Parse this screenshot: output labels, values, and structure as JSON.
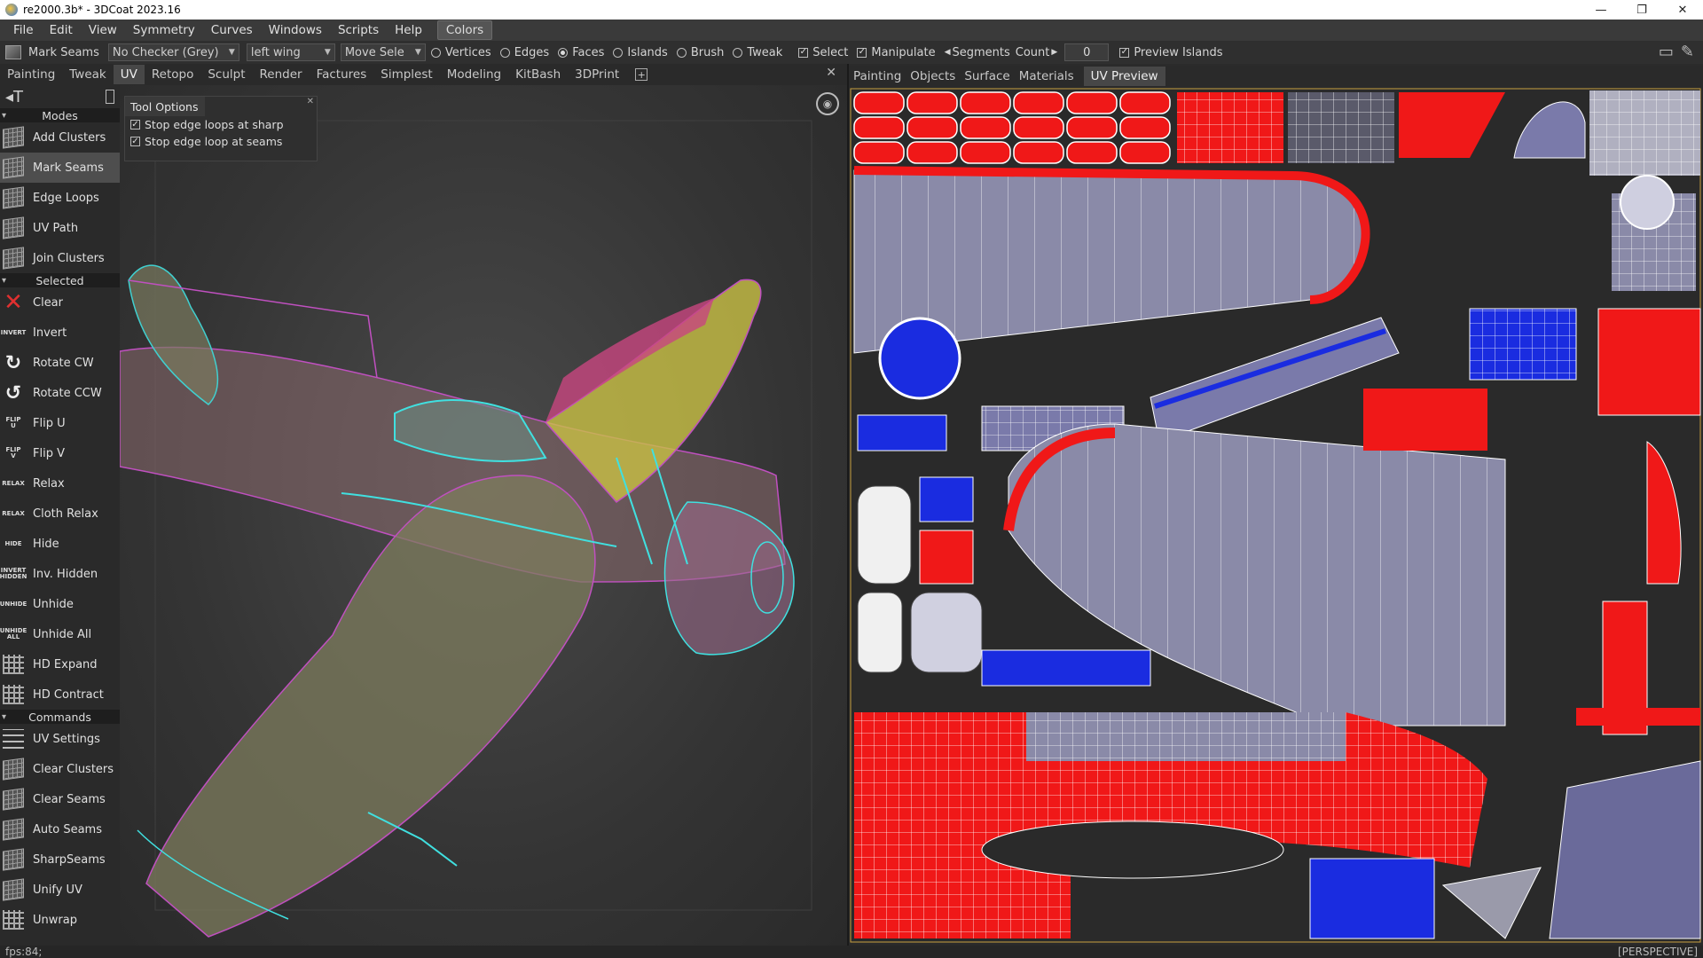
{
  "window": {
    "title": "re2000.3b* - 3DCoat 2023.16",
    "controls": [
      "—",
      "❐",
      "✕"
    ]
  },
  "menu": [
    "File",
    "Edit",
    "View",
    "Symmetry",
    "Curves",
    "Windows",
    "Scripts",
    "Help",
    "Colors"
  ],
  "toolbar": {
    "tool_label": "Mark Seams",
    "checker": "No Checker (Grey)",
    "object": "left wing",
    "move_sel": "Move Sele",
    "modes": [
      {
        "label": "Vertices",
        "on": false
      },
      {
        "label": "Edges",
        "on": false
      },
      {
        "label": "Faces",
        "on": true
      },
      {
        "label": "Islands",
        "on": false
      },
      {
        "label": "Brush",
        "on": false
      },
      {
        "label": "Tweak",
        "on": false
      }
    ],
    "select": "Select",
    "manipulate": "Manipulate",
    "segments_label": "Segments",
    "count_label": "Count",
    "count_value": "0",
    "preview_islands": "Preview Islands"
  },
  "tabs_left": [
    "Painting",
    "Tweak",
    "UV",
    "Retopo",
    "Sculpt",
    "Render",
    "Factures",
    "Simplest",
    "Modeling",
    "KitBash",
    "3DPrint"
  ],
  "tabs_left_active": "UV",
  "tabs_right": [
    "Painting",
    "Objects",
    "Surface",
    "Materials",
    "UV Preview"
  ],
  "tabs_right_active": "UV Preview",
  "panel": {
    "sections": {
      "modes": "Modes",
      "selected": "Selected",
      "commands": "Commands"
    },
    "modes": [
      {
        "label": "Add Clusters",
        "icon": "mesh-icon"
      },
      {
        "label": "Mark Seams",
        "icon": "mesh-icon",
        "active": true
      },
      {
        "label": "Edge Loops",
        "icon": "mesh-icon"
      },
      {
        "label": "UV Path",
        "icon": "mesh-icon"
      },
      {
        "label": "Join Clusters",
        "icon": "mesh-icon"
      }
    ],
    "selected": [
      {
        "label": "Clear",
        "icon_text": "✕"
      },
      {
        "label": "Invert",
        "icon_text": "INVERT"
      },
      {
        "label": "Rotate CW",
        "icon_text": "↻"
      },
      {
        "label": "Rotate CCW",
        "icon_text": "↺"
      },
      {
        "label": "Flip U",
        "icon_text": "FLIP U"
      },
      {
        "label": "Flip V",
        "icon_text": "FLIP V"
      },
      {
        "label": "Relax",
        "icon_text": "RELAX"
      },
      {
        "label": "Cloth Relax",
        "icon_text": "RELAX"
      },
      {
        "label": "Hide",
        "icon_text": "HIDE"
      },
      {
        "label": "Inv. Hidden",
        "icon_text": "INVERT HIDDEN"
      },
      {
        "label": "Unhide",
        "icon_text": "UNHIDE"
      },
      {
        "label": "Unhide All",
        "icon_text": "UNHIDE ALL"
      },
      {
        "label": "HD Expand",
        "icon_text": ""
      },
      {
        "label": "HD Contract",
        "icon_text": ""
      }
    ],
    "commands": [
      {
        "label": "UV Settings"
      },
      {
        "label": "Clear Clusters"
      },
      {
        "label": "Clear Seams"
      },
      {
        "label": "Auto Seams"
      },
      {
        "label": "SharpSeams"
      },
      {
        "label": "Unify UV"
      },
      {
        "label": "Unwrap"
      }
    ]
  },
  "tool_options": {
    "title": "Tool Options",
    "options": [
      {
        "label": "Stop edge loops at sharp",
        "checked": true
      },
      {
        "label": "Stop edge loop at seams",
        "checked": true
      }
    ]
  },
  "status": {
    "fps": "fps:84;",
    "view": "[PERSPECTIVE]"
  },
  "colors": {
    "uv_red": "#f01818",
    "uv_blue": "#1a2ce0",
    "uv_grey": "#8a8aa8",
    "accent_bg": "#2b2b2b"
  }
}
